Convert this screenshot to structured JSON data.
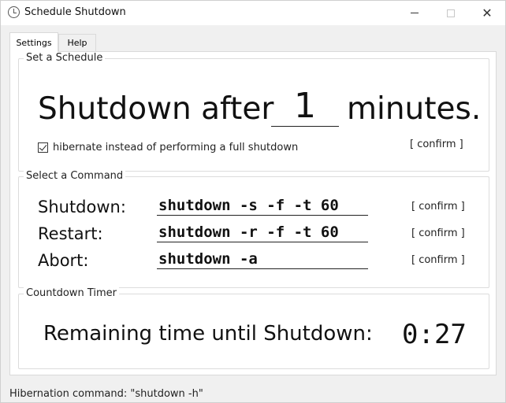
{
  "window": {
    "title": "Schedule Shutdown",
    "minimize_icon": "minimize-icon",
    "maximize_icon": "maximize-icon",
    "close_icon": "close-icon",
    "close_glyph": "✕"
  },
  "tabs": [
    {
      "label": "Settings",
      "active": true
    },
    {
      "label": "Help",
      "active": false
    }
  ],
  "schedule": {
    "legend": "Set a Schedule",
    "prefix": "Shutdown after",
    "minutes_value": "1",
    "suffix": "minutes.",
    "hibernate_label": "hibernate instead of performing a full shutdown",
    "hibernate_checked": true,
    "confirm_label": "[ confirm ]"
  },
  "commands": {
    "legend": "Select a Command",
    "items": [
      {
        "label": "Shutdown:",
        "value": "shutdown -s -f -t 60",
        "confirm_label": "[ confirm ]"
      },
      {
        "label": "Restart:",
        "value": "shutdown -r -f -t 60",
        "confirm_label": "[ confirm ]"
      },
      {
        "label": "Abort:",
        "value": "shutdown -a",
        "confirm_label": "[ confirm ]"
      }
    ]
  },
  "countdown": {
    "legend": "Countdown Timer",
    "label": "Remaining time until Shutdown:",
    "value": "0:27"
  },
  "status": {
    "text": "Hibernation command: \"shutdown -h\""
  }
}
